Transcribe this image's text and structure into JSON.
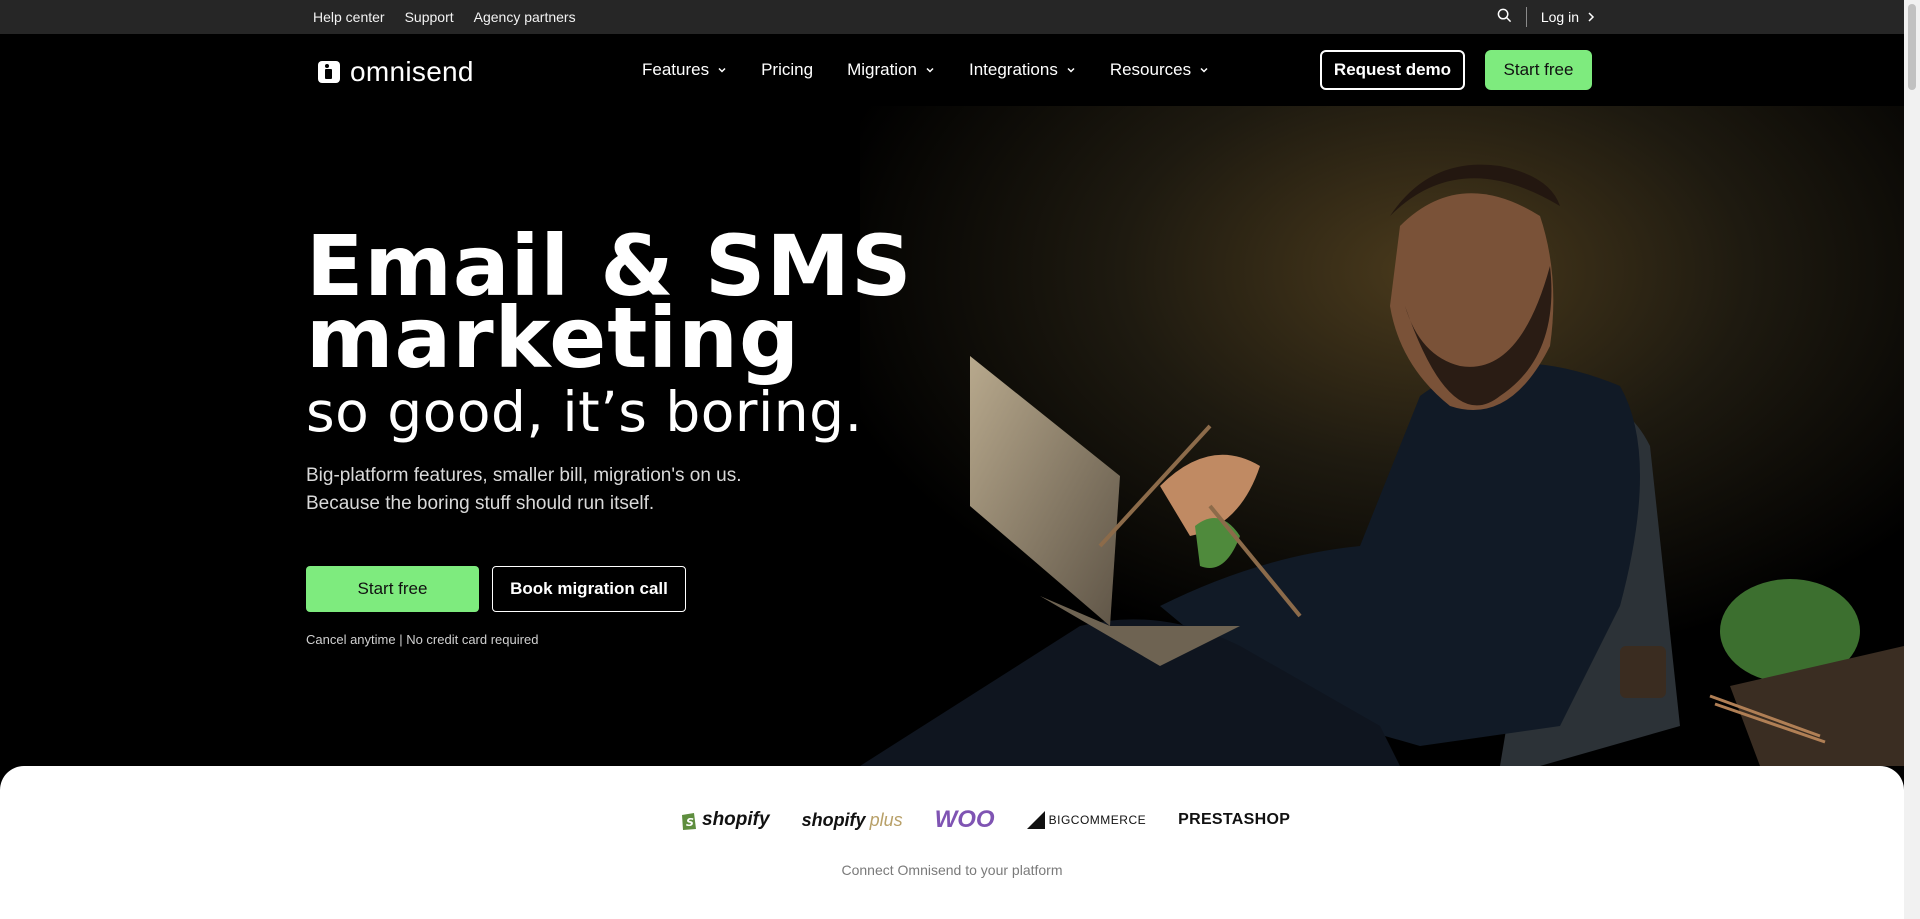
{
  "topbar": {
    "links": [
      "Help center",
      "Support",
      "Agency partners"
    ],
    "login_label": "Log in"
  },
  "nav": {
    "brand": "omnisend",
    "menu": [
      {
        "label": "Features",
        "has_dropdown": true
      },
      {
        "label": "Pricing",
        "has_dropdown": false
      },
      {
        "label": "Migration",
        "has_dropdown": true
      },
      {
        "label": "Integrations",
        "has_dropdown": true
      },
      {
        "label": "Resources",
        "has_dropdown": true
      }
    ],
    "request_demo": "Request demo",
    "start_free": "Start free"
  },
  "hero": {
    "headline_line1": "Email & SMS",
    "headline_line2": "marketing",
    "subheadline": "so good, it’s boring.",
    "desc_line1": "Big-platform features, smaller bill, migration's on us.",
    "desc_line2": "Because the boring stuff should run itself.",
    "primary_cta": "Start free",
    "secondary_cta": "Book migration call",
    "note": "Cancel anytime | No credit card required"
  },
  "platforms": {
    "logos": [
      "shopify",
      "shopify",
      "plus",
      "WOO",
      "BIGCOMMERCE",
      "PRESTASHOP"
    ],
    "caption": "Connect Omnisend to your platform"
  },
  "colors": {
    "accent_green": "#7eeb7e",
    "background": "#000000",
    "topbar": "#262626",
    "woo_purple": "#7f54b3"
  }
}
